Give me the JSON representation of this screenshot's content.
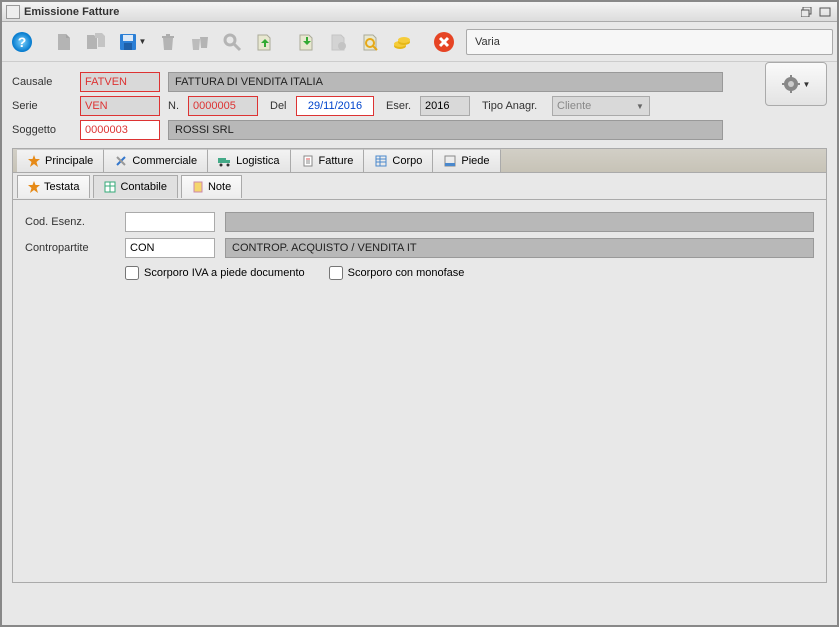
{
  "window": {
    "title": "Emissione Fatture"
  },
  "toolbar": {
    "status": "Varia"
  },
  "header": {
    "labels": {
      "causale": "Causale",
      "serie": "Serie",
      "n": "N.",
      "del": "Del",
      "eser": "Eser.",
      "tipo_anagr": "Tipo Anagr.",
      "soggetto": "Soggetto"
    },
    "causale": "FATVEN",
    "causale_desc": "FATTURA DI VENDITA ITALIA",
    "serie": "VEN",
    "numero": "0000005",
    "del": "29/11/2016",
    "eser": "2016",
    "tipo_anagr": "Cliente",
    "soggetto": "0000003",
    "soggetto_desc": "ROSSI SRL"
  },
  "tabs_primary": [
    {
      "id": "principale",
      "label": "Principale"
    },
    {
      "id": "commerciale",
      "label": "Commerciale"
    },
    {
      "id": "logistica",
      "label": "Logistica"
    },
    {
      "id": "fatture",
      "label": "Fatture"
    },
    {
      "id": "corpo",
      "label": "Corpo"
    },
    {
      "id": "piede",
      "label": "Piede"
    }
  ],
  "tabs_secondary": [
    {
      "id": "testata",
      "label": "Testata"
    },
    {
      "id": "contabile",
      "label": "Contabile"
    },
    {
      "id": "note",
      "label": "Note"
    }
  ],
  "contabile": {
    "labels": {
      "cod_esenz": "Cod. Esenz.",
      "contropartite": "Contropartite"
    },
    "cod_esenz": "",
    "cod_esenz_desc": "",
    "contropartite": "CON",
    "contropartite_desc": "CONTROP. ACQUISTO / VENDITA IT",
    "chk_scorporo_iva": "Scorporo IVA a piede documento",
    "chk_scorporo_mono": "Scorporo con monofase"
  }
}
